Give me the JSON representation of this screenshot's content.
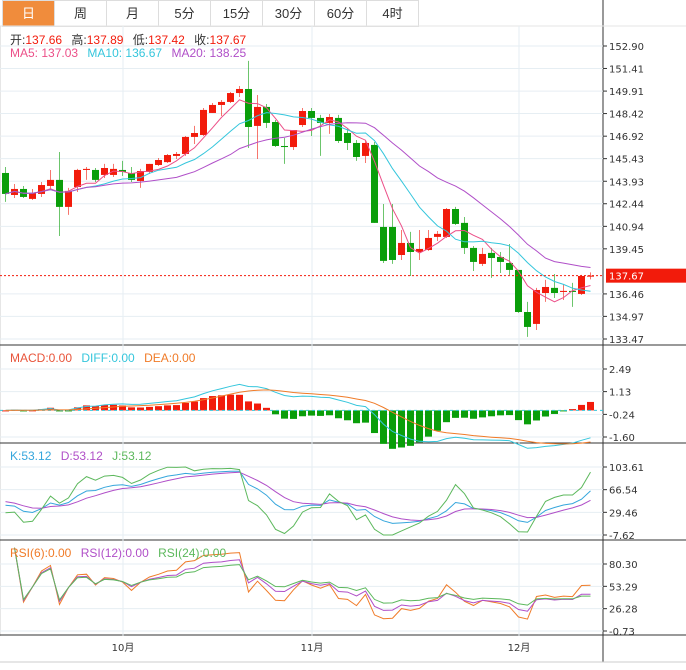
{
  "tabs": [
    "日",
    "周",
    "月",
    "5分",
    "15分",
    "30分",
    "60分",
    "4时"
  ],
  "active_tab": 0,
  "ohlc_info": {
    "open_label": "开:",
    "open": "137.66",
    "high_label": "高:",
    "high": "137.89",
    "low_label": "低:",
    "low": "137.42",
    "close_label": "收:",
    "close": "137.67"
  },
  "ma_info": {
    "ma5": "MA5: 137.03",
    "ma10": "MA10: 136.67",
    "ma20": "MA20: 138.25"
  },
  "macd_info": {
    "macd": "MACD:0.00",
    "diff": "DIFF:0.00",
    "dea": "DEA:0.00"
  },
  "kdj_info": {
    "k": "K:53.12",
    "d": "D:53.12",
    "j": "J:53.12"
  },
  "rsi_info": {
    "rsi6": "RSI(6):0.00",
    "rsi12": "RSI(12):0.00",
    "rsi24": "RSI(24):0.00"
  },
  "current_price": "137.67",
  "colors": {
    "up": "#f21b0b",
    "down": "#0a9e0a",
    "ma5": "#ec4f88",
    "ma10": "#35c6dc",
    "ma20": "#b04fc8",
    "accent": "#f08c3c"
  },
  "chart_data": {
    "type": "candlestick",
    "price_ticks": [
      "152.90",
      "151.41",
      "149.91",
      "148.42",
      "146.92",
      "145.43",
      "143.93",
      "142.44",
      "140.94",
      "139.45",
      "136.46",
      "134.97",
      "133.47"
    ],
    "price_range": [
      133.47,
      152.9
    ],
    "macd_ticks": [
      "2.49",
      "1.13",
      "-0.24",
      "-1.60"
    ],
    "macd_range": [
      -1.6,
      2.49
    ],
    "kdj_ticks": [
      "103.61",
      "66.54",
      "29.46",
      "-7.62"
    ],
    "kdj_range": [
      -7.62,
      103.61
    ],
    "rsi_ticks": [
      "80.30",
      "53.29",
      "26.28",
      "-0.73"
    ],
    "rsi_range": [
      -0.73,
      80.3
    ],
    "x_labels": [
      {
        "label": "10月",
        "index": 13
      },
      {
        "label": "11月",
        "index": 34
      },
      {
        "label": "12月",
        "index": 57
      }
    ],
    "candles": [
      [
        144.48,
        144.88,
        142.56,
        143.09
      ],
      [
        143.02,
        143.75,
        142.82,
        143.42
      ],
      [
        143.42,
        143.62,
        142.82,
        142.89
      ],
      [
        142.76,
        143.42,
        142.69,
        143.15
      ],
      [
        143.09,
        143.88,
        142.89,
        143.68
      ],
      [
        143.62,
        144.68,
        143.35,
        144.02
      ],
      [
        144.02,
        145.87,
        140.3,
        142.23
      ],
      [
        142.23,
        143.49,
        141.7,
        143.29
      ],
      [
        143.55,
        144.75,
        143.22,
        144.68
      ],
      [
        144.68,
        144.88,
        144.02,
        144.75
      ],
      [
        144.68,
        144.81,
        143.88,
        144.02
      ],
      [
        144.35,
        145.08,
        144.15,
        144.81
      ],
      [
        144.35,
        145.08,
        144.21,
        144.75
      ],
      [
        144.68,
        145.28,
        144.28,
        144.55
      ],
      [
        144.48,
        144.88,
        143.88,
        144.02
      ],
      [
        143.95,
        144.75,
        143.49,
        144.61
      ],
      [
        144.55,
        145.08,
        144.41,
        145.08
      ],
      [
        145.01,
        145.47,
        144.94,
        145.34
      ],
      [
        145.2,
        145.74,
        145.14,
        145.67
      ],
      [
        145.61,
        145.87,
        145.41,
        145.74
      ],
      [
        145.74,
        146.93,
        145.61,
        146.87
      ],
      [
        146.87,
        147.6,
        146.4,
        147.13
      ],
      [
        147.0,
        148.79,
        146.93,
        148.66
      ],
      [
        148.46,
        149.12,
        148.46,
        148.99
      ],
      [
        148.99,
        149.32,
        148.26,
        149.19
      ],
      [
        149.19,
        149.85,
        149.12,
        149.78
      ],
      [
        149.78,
        150.25,
        149.52,
        150.05
      ],
      [
        150.05,
        151.91,
        146.14,
        147.53
      ],
      [
        147.6,
        149.65,
        145.41,
        148.86
      ],
      [
        148.86,
        149.05,
        147.46,
        147.8
      ],
      [
        147.86,
        147.99,
        146.2,
        146.27
      ],
      [
        146.27,
        146.8,
        145.08,
        146.2
      ],
      [
        146.2,
        147.33,
        146.0,
        147.33
      ],
      [
        147.66,
        148.79,
        147.53,
        148.59
      ],
      [
        148.59,
        148.79,
        146.93,
        148.13
      ],
      [
        148.13,
        148.33,
        145.61,
        147.8
      ],
      [
        147.8,
        148.39,
        147.07,
        148.19
      ],
      [
        148.13,
        148.33,
        146.47,
        146.6
      ],
      [
        147.13,
        147.46,
        146.0,
        146.47
      ],
      [
        146.47,
        146.67,
        145.28,
        145.54
      ],
      [
        145.61,
        146.67,
        145.14,
        146.47
      ],
      [
        146.34,
        146.54,
        141.17,
        141.17
      ],
      [
        140.9,
        142.42,
        138.51,
        138.65
      ],
      [
        140.9,
        142.42,
        138.45,
        138.71
      ],
      [
        139.04,
        140.7,
        138.71,
        139.84
      ],
      [
        139.84,
        140.57,
        137.65,
        139.24
      ],
      [
        139.24,
        140.7,
        138.71,
        139.44
      ],
      [
        139.37,
        140.7,
        139.31,
        140.17
      ],
      [
        140.24,
        140.63,
        139.97,
        140.44
      ],
      [
        140.24,
        142.16,
        140.17,
        142.09
      ],
      [
        142.09,
        142.23,
        141.03,
        141.1
      ],
      [
        141.17,
        141.56,
        139.11,
        139.51
      ],
      [
        139.51,
        139.64,
        137.98,
        138.58
      ],
      [
        138.45,
        139.51,
        138.31,
        139.11
      ],
      [
        139.18,
        139.51,
        137.52,
        138.84
      ],
      [
        138.91,
        139.24,
        137.85,
        138.58
      ],
      [
        138.51,
        139.77,
        137.72,
        138.05
      ],
      [
        138.05,
        138.05,
        135.2,
        135.26
      ],
      [
        135.26,
        135.93,
        133.61,
        134.27
      ],
      [
        134.47,
        136.86,
        134.07,
        136.72
      ],
      [
        136.52,
        137.39,
        135.93,
        136.92
      ],
      [
        136.86,
        137.78,
        136.19,
        136.52
      ],
      [
        136.59,
        137.12,
        136.06,
        136.66
      ],
      [
        136.66,
        137.19,
        135.6,
        136.59
      ],
      [
        136.46,
        137.72,
        136.39,
        137.65
      ],
      [
        137.66,
        137.89,
        137.42,
        137.67
      ]
    ]
  }
}
